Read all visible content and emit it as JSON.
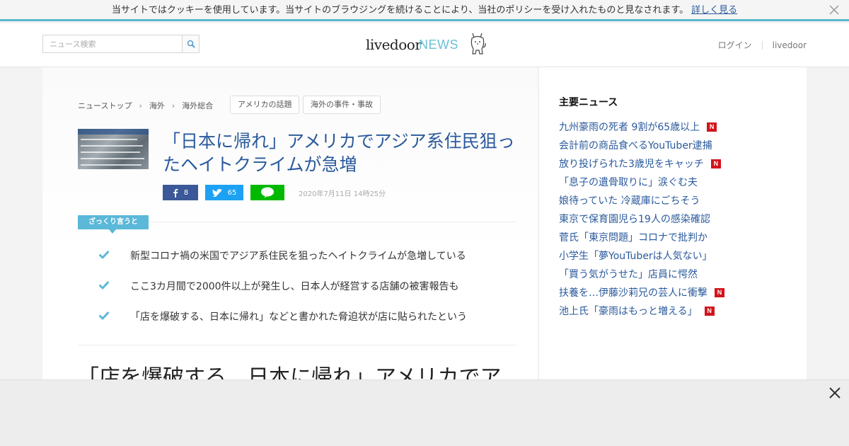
{
  "cookie": {
    "message": "当サイトではクッキーを使用しています。当サイトのブラウジングを続けることにより、当社のポリシーを受け入れたものと見なされます。",
    "link": "詳しく見る"
  },
  "header": {
    "search_placeholder": "ニュース検索",
    "logo_main": "livedoor",
    "logo_news": "NEWS",
    "login": "ログイン",
    "livedoor_link": "livedoor"
  },
  "breadcrumb": [
    "ニューストップ",
    "海外",
    "海外総合"
  ],
  "tags": [
    "アメリカの話題",
    "海外の事件・事故"
  ],
  "article": {
    "title": "「日本に帰れ」アメリカでアジア系住民狙ったヘイトクライムが急増",
    "date": "2020年7月11日 14時25分",
    "fb_count": "8",
    "tw_count": "65",
    "line_label": "LINE",
    "zakkuri_label": "ざっくり言うと",
    "points": [
      "新型コロナ禍の米国でアジア系住民を狙ったヘイトクライムが急増している",
      "ここ3カ月間で2000件以上が発生し、日本人が経営する店舗の被害報告も",
      "「店を爆破する、日本に帰れ」などと書かれた脅迫状が店に貼られたという"
    ],
    "sub_heading": "「店を爆破する、日本に帰れ」アメリカでア"
  },
  "sidebar": {
    "title": "主要ニュース",
    "badge": "N",
    "items": [
      {
        "text": "九州豪雨の死者 9割が65歳以上",
        "new": true
      },
      {
        "text": "会計前の商品食べるYouTuber逮捕",
        "new": false
      },
      {
        "text": "放り投げられた3歳児をキャッチ",
        "new": true
      },
      {
        "text": "「息子の遺骨取りに」涙ぐむ夫",
        "new": false
      },
      {
        "text": "娘待っていた 冷蔵庫にごちそう",
        "new": false
      },
      {
        "text": "東京で保育園児ら19人の感染確認",
        "new": false
      },
      {
        "text": "菅氏「東京問題」コロナで批判か",
        "new": false
      },
      {
        "text": "小学生「夢YouTuberは人気ない」",
        "new": false
      },
      {
        "text": "「買う気がうせた」店員に愕然",
        "new": false
      },
      {
        "text": "扶養を…伊藤沙莉兄の芸人に衝撃",
        "new": true
      },
      {
        "text": "池上氏「豪雨はもっと増える」",
        "new": true
      }
    ]
  },
  "colors": {
    "accent": "#5bb8d8",
    "link": "#2a5a9c",
    "facebook": "#3b5998",
    "twitter": "#1da1f2",
    "line": "#00b900",
    "new_badge": "#d4131c"
  }
}
